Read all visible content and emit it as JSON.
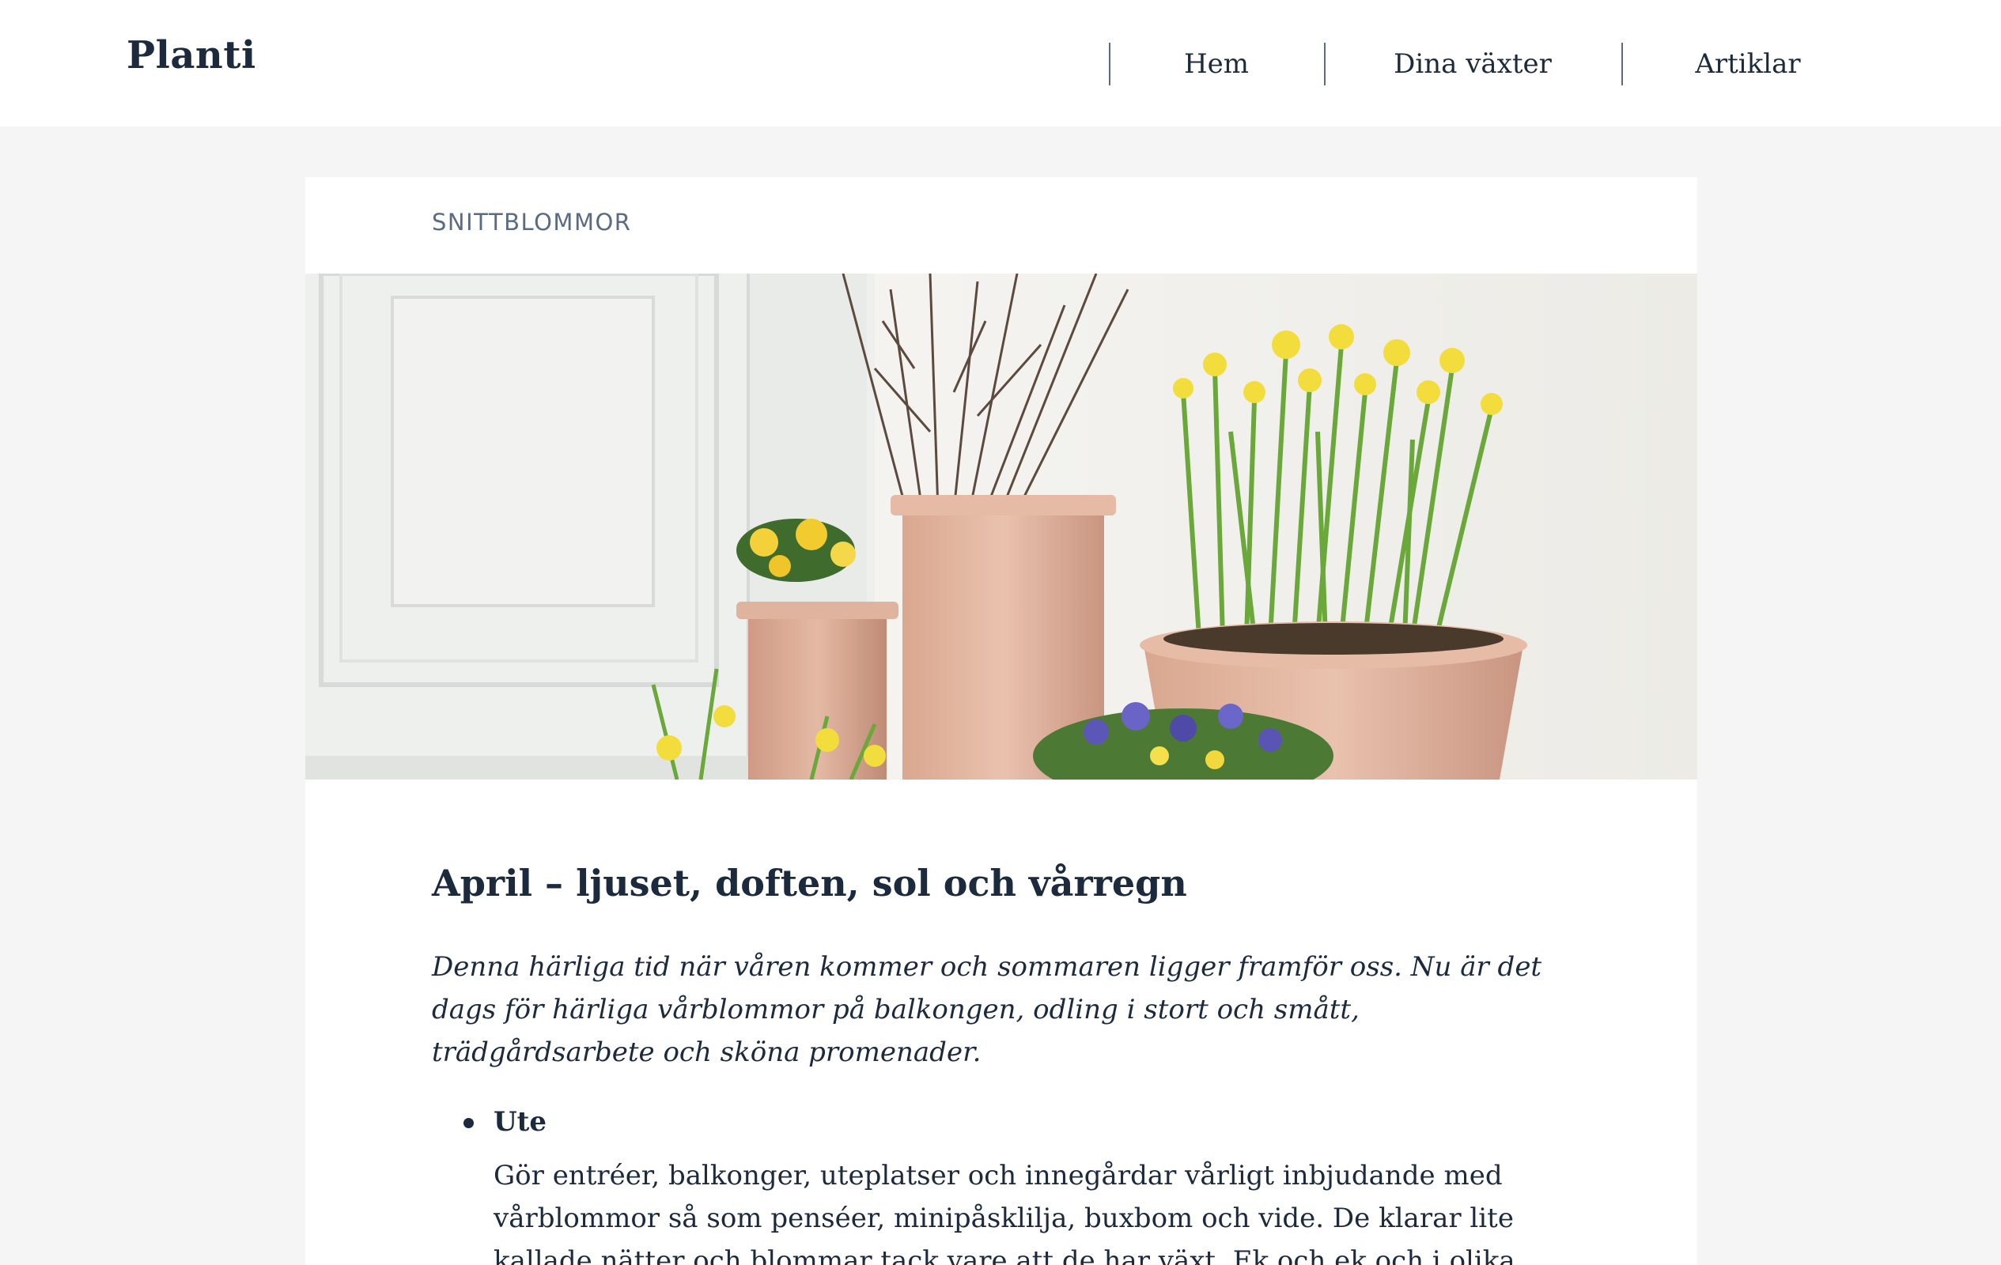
{
  "site": {
    "logo": "Planti"
  },
  "nav": {
    "items": [
      {
        "label": "Hem"
      },
      {
        "label": "Dina växter"
      },
      {
        "label": "Artiklar"
      }
    ]
  },
  "article": {
    "category": "SNITTBLOMMOR",
    "title": "April – ljuset, doften, sol och vårregn",
    "ingress": "Denna härliga tid när våren kommer och sommaren ligger framför oss. Nu är det dags för härliga vårblommor på balkongen, odling i stort och smått, trädgårdsarbete och sköna promenader.",
    "list": [
      {
        "title": "Ute",
        "body": "Gör entréer, balkonger, uteplatser och innegårdar vårligt inbjudande med vårblommor så som penséer, minipåsklilja, buxbom och vide. De klarar lite kallade nätter och blommar tack vare att de har växt. Ek och ek och i olika storlek och i"
      }
    ]
  },
  "colors": {
    "text": "#1c2a3e",
    "muted": "#5b6b82",
    "background": "#f5f5f5",
    "card": "#ffffff"
  }
}
